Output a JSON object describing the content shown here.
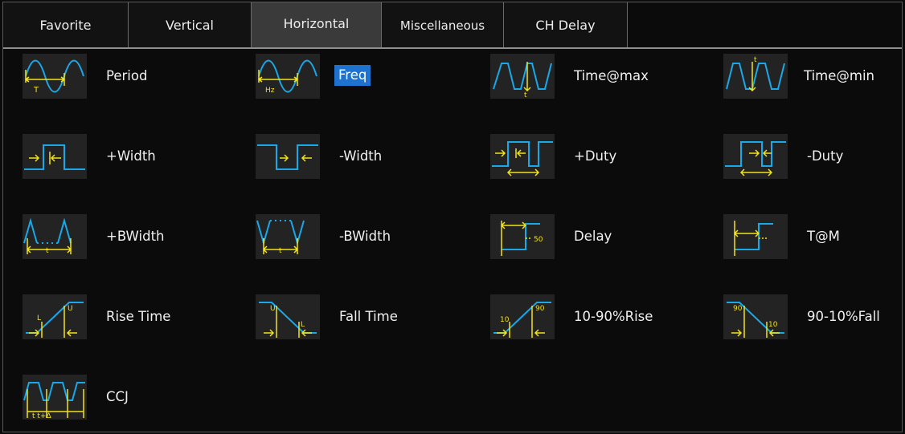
{
  "tabs": [
    "Favorite",
    "Vertical",
    "Horizontal",
    "Miscellaneous",
    "CH Delay"
  ],
  "active_tab": "Horizontal",
  "items": [
    {
      "label": "Period",
      "icon": "period-waveform-icon"
    },
    {
      "label": "Freq",
      "icon": "frequency-waveform-icon",
      "selected": true
    },
    {
      "label": "Time@max",
      "icon": "time-at-max-icon"
    },
    {
      "label": "Time@min",
      "icon": "time-at-min-icon"
    },
    {
      "label": "+Width",
      "icon": "positive-width-icon"
    },
    {
      "label": "-Width",
      "icon": "negative-width-icon"
    },
    {
      "label": "+Duty",
      "icon": "positive-duty-icon"
    },
    {
      "label": "-Duty",
      "icon": "negative-duty-icon"
    },
    {
      "label": "+BWidth",
      "icon": "positive-burst-width-icon"
    },
    {
      "label": "-BWidth",
      "icon": "negative-burst-width-icon"
    },
    {
      "label": "Delay",
      "icon": "delay-icon"
    },
    {
      "label": "T@M",
      "icon": "time-at-middle-icon"
    },
    {
      "label": "Rise Time",
      "icon": "rise-time-icon"
    },
    {
      "label": "Fall Time",
      "icon": "fall-time-icon"
    },
    {
      "label": "10-90%Rise",
      "icon": "rise-10-90-icon"
    },
    {
      "label": "90-10%Fall",
      "icon": "fall-90-10-icon"
    },
    {
      "label": "CCJ",
      "icon": "cycle-cycle-jitter-icon"
    }
  ],
  "icon_text": {
    "period": "T",
    "freq": "Hz",
    "t": "t",
    "fifty": "50",
    "upper": "U",
    "lower": "L",
    "ten": "10",
    "ninety": "90",
    "ccj": "t t+Δ"
  },
  "colors": {
    "wave": "#19a8e8",
    "marker": "#f2e21c",
    "highlight": "#1e73d0",
    "background": "#0b0b0b"
  }
}
